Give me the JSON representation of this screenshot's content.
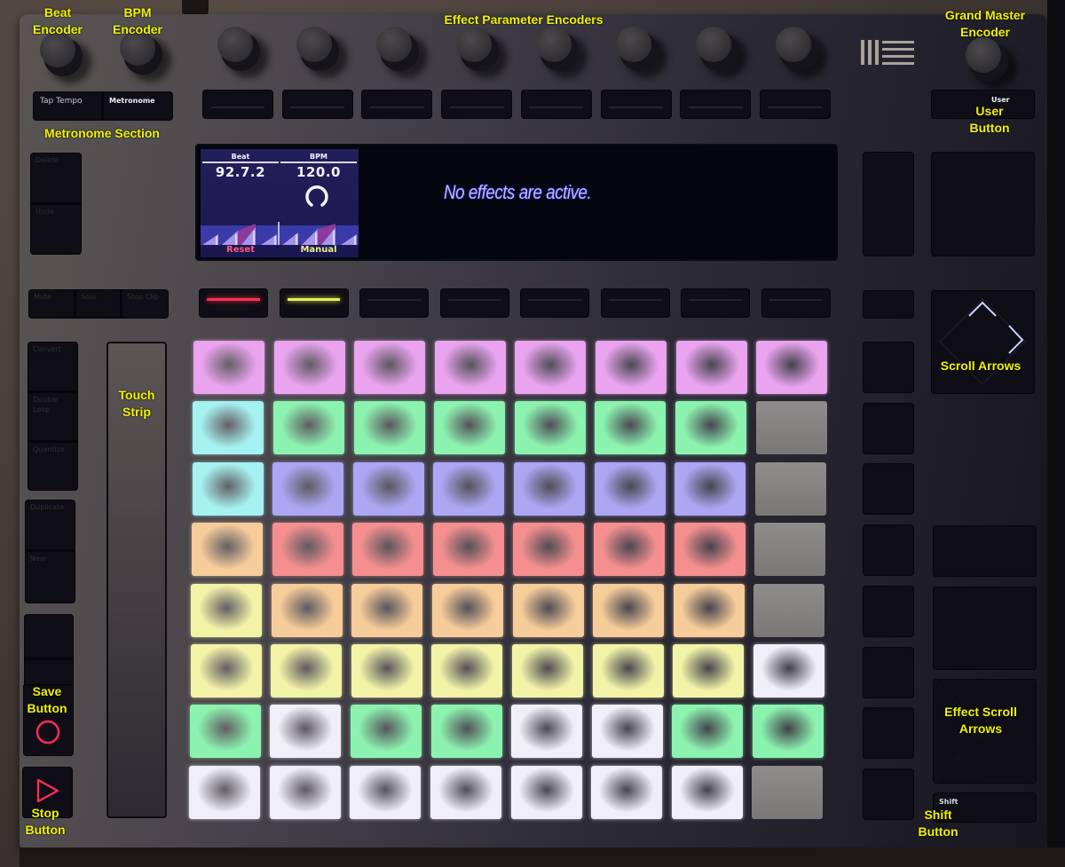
{
  "annotations": {
    "beat_encoder": [
      "Beat",
      "Encoder"
    ],
    "bpm_encoder": [
      "BPM",
      "Encoder"
    ],
    "effect_parameter_encoders": "Effect Parameter Encoders",
    "grand_master_encoder": [
      "Grand Master",
      "Encoder"
    ],
    "metronome_section": "Metronome Section",
    "user_button": [
      "User",
      "Button"
    ],
    "touch_strip": [
      "Touch",
      "Strip"
    ],
    "scroll_arrows": "Scroll Arrows",
    "effect_scroll_arrows": [
      "Effect Scroll",
      "Arrows"
    ],
    "save_button": [
      "Save",
      "Button"
    ],
    "stop_button": [
      "Stop",
      "Button"
    ],
    "shift_button": [
      "Shift",
      "Button"
    ]
  },
  "buttons": {
    "tap_tempo": "Tap Tempo",
    "metronome": "Metronome",
    "user": "User",
    "shift": "Shift",
    "delete": "Delete",
    "undo": "Undo",
    "mute": "Mute",
    "solo": "Solo",
    "stop_clip": "Stop Clip",
    "convert": "Convert",
    "double_loop": "Double Loop",
    "quantize": "Quantize",
    "duplicate": "Duplicate",
    "new": "New"
  },
  "display": {
    "beat_header": "Beat",
    "beat_value": "92.7.2",
    "bpm_header": "BPM",
    "bpm_value": "120.0",
    "reset_label": "Reset",
    "manual_label": "Manual",
    "message": "No effects are active.",
    "colors": {
      "reset": "#ff5a78",
      "manual": "#eaf08a",
      "message": "#b9b9ff"
    }
  },
  "upper_row_leds": [
    {
      "state": "red",
      "color": "#ff3050"
    },
    {
      "state": "yellow",
      "color": "#e8ef55"
    },
    {
      "state": "off"
    },
    {
      "state": "off"
    },
    {
      "state": "off"
    },
    {
      "state": "off"
    },
    {
      "state": "off"
    },
    {
      "state": "off"
    }
  ],
  "pads": {
    "colors": {
      "P": "#e9a3ef",
      "C": "#a6f1f1",
      "G": "#8cf2b0",
      "B": "#ada6f2",
      "R": "#f58f8f",
      "O": "#f6cc9a",
      "Y": "#f3f3a8",
      "W": "#f0eef7",
      "X": "#8a8886"
    },
    "rows": [
      [
        "P",
        "P",
        "P",
        "P",
        "P",
        "P",
        "P",
        "P"
      ],
      [
        "C",
        "G",
        "G",
        "G",
        "G",
        "G",
        "G",
        "X"
      ],
      [
        "C",
        "B",
        "B",
        "B",
        "B",
        "B",
        "B",
        "X"
      ],
      [
        "O",
        "R",
        "R",
        "R",
        "R",
        "R",
        "R",
        "X"
      ],
      [
        "Y",
        "O",
        "O",
        "O",
        "O",
        "O",
        "O",
        "X"
      ],
      [
        "Y",
        "Y",
        "Y",
        "Y",
        "Y",
        "Y",
        "Y",
        "W"
      ],
      [
        "G",
        "W",
        "G",
        "G",
        "W",
        "W",
        "G",
        "G"
      ],
      [
        "W",
        "W",
        "W",
        "W",
        "W",
        "W",
        "W",
        "X"
      ]
    ]
  },
  "transport": {
    "save_icon_color": "#ff2d55",
    "stop_icon_color": "#ff2d55"
  }
}
